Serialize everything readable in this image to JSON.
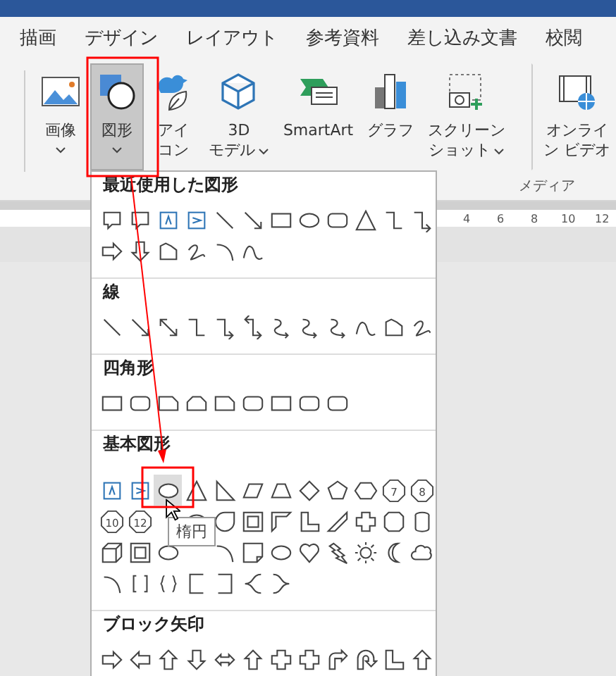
{
  "tabs": [
    {
      "label": "描画",
      "selected": false
    },
    {
      "label": "デザイン",
      "selected": false
    },
    {
      "label": "レイアウト",
      "selected": false
    },
    {
      "label": "参考資料",
      "selected": false
    },
    {
      "label": "差し込み文書",
      "selected": false
    },
    {
      "label": "校閲",
      "selected": false
    }
  ],
  "ribbon": {
    "buttons": [
      {
        "kind": "picture",
        "label_lines": [
          "画像"
        ],
        "dropdown": true,
        "selected": false
      },
      {
        "kind": "shapes",
        "label_lines": [
          "図形"
        ],
        "dropdown": true,
        "selected": true
      },
      {
        "kind": "icon",
        "label_lines": [
          "アイ",
          "コン"
        ],
        "dropdown": false,
        "selected": false
      },
      {
        "kind": "cube",
        "label_lines": [
          "3D",
          "モデル"
        ],
        "dropdown": true,
        "selected": false
      },
      {
        "kind": "smartart",
        "label_lines": [
          "SmartArt"
        ],
        "dropdown": false,
        "selected": false
      },
      {
        "kind": "chart",
        "label_lines": [
          "グラフ"
        ],
        "dropdown": false,
        "selected": false
      },
      {
        "kind": "screenshot",
        "label_lines": [
          "スクリーン",
          "ショット"
        ],
        "dropdown": true,
        "selected": false
      },
      {
        "kind": "video",
        "label_lines": [
          "オンライ",
          "ン ビデオ"
        ],
        "dropdown": false,
        "selected": false
      }
    ],
    "group_label": "メディア"
  },
  "ruler": [
    "4",
    "6",
    "8",
    "10",
    "12"
  ],
  "shapes_menu": {
    "sections": [
      {
        "kind": "recent",
        "title": "最近使用した図形"
      },
      {
        "kind": "lines",
        "title": "線"
      },
      {
        "kind": "rectangles",
        "title": "四角形"
      },
      {
        "kind": "basic",
        "title": "基本図形",
        "numbers": [
          "7",
          "8",
          "10",
          "12"
        ]
      },
      {
        "kind": "block",
        "title": "ブロック矢印"
      }
    ],
    "tooltip": "楕円"
  }
}
